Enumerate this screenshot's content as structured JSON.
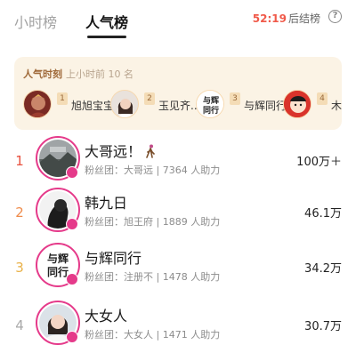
{
  "header": {
    "tabs": [
      {
        "label": "小时榜",
        "active": false
      },
      {
        "label": "人气榜",
        "active": true
      }
    ],
    "countdown_time": "52:19",
    "countdown_suffix": "后结榜",
    "help_icon": "?"
  },
  "moments": {
    "title": "人气时刻",
    "subtitle": "上小时前 10 名",
    "items": [
      {
        "rank": "1",
        "name": "旭旭宝宝",
        "avatar": "avatar-warrior"
      },
      {
        "rank": "2",
        "name": "玉见齐...",
        "avatar": "avatar-woman"
      },
      {
        "rank": "3",
        "name": "与辉同行",
        "avatar": "avatar-calligraphy"
      },
      {
        "rank": "4",
        "name": "木",
        "avatar": "avatar-cartoon"
      }
    ]
  },
  "ranking": [
    {
      "rank": "1",
      "name": "大哥远！",
      "fans_label": "粉丝团：大哥远 | 7364 人助力",
      "score": "100万＋",
      "rank_color": "#e8513f",
      "icon": "person-walking-icon"
    },
    {
      "rank": "2",
      "name": "韩九日",
      "fans_label": "粉丝团：旭王府 | 1889 人助力",
      "score": "46.1万",
      "rank_color": "#ef8b4b"
    },
    {
      "rank": "3",
      "name": "与辉同行",
      "fans_label": "粉丝团：注册不 | 1478 人助力",
      "score": "34.2万",
      "rank_color": "#e9b24a"
    },
    {
      "rank": "4",
      "name": "大女人",
      "fans_label": "粉丝团：大女人 | 1471 人助力",
      "score": "30.7万",
      "rank_color": "#a9a9a9"
    }
  ],
  "colors": {
    "accent": "#e53a8a",
    "countdown": "#f05a4a",
    "moments_bg": "#fbf3e5"
  }
}
